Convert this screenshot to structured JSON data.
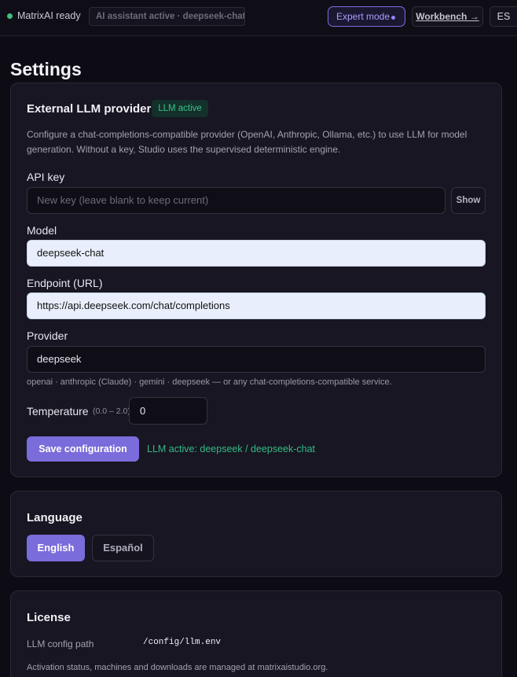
{
  "topbar": {
    "status_text": "MatrixAI ready",
    "status_color": "#3fbf7f",
    "assistant_text": "AI assistant active · deepseek-chat",
    "expert_mode_label": "Expert mode",
    "workbench_label": "Workbench →",
    "language_toggle": "ES"
  },
  "page": {
    "title": "Settings"
  },
  "llm_card": {
    "title": "External LLM provider",
    "badge": "LLM active",
    "description": "Configure a chat-completions-compatible provider (OpenAI, Anthropic, Ollama, etc.) to use LLM for model generation. Without a key, Studio uses the supervised deterministic engine.",
    "api_key": {
      "label": "API key",
      "placeholder": "New key (leave blank to keep current)",
      "show_label": "Show"
    },
    "model": {
      "label": "Model",
      "value": "deepseek-chat"
    },
    "endpoint": {
      "label": "Endpoint (URL)",
      "value": "https://api.deepseek.com/chat/completions"
    },
    "provider": {
      "label": "Provider",
      "value": "deepseek",
      "hint": "openai · anthropic (Claude) · gemini · deepseek — or any chat-completions-compatible service."
    },
    "temperature": {
      "label": "Temperature",
      "range": "(0.0 – 2.0)",
      "value": "0"
    },
    "save_label": "Save configuration",
    "save_status": "LLM active: deepseek / deepseek-chat"
  },
  "language_card": {
    "title": "Language",
    "options": [
      "English",
      "Español"
    ],
    "selected": "English"
  },
  "license_card": {
    "title": "License",
    "config_path_label": "LLM config path",
    "config_path_value": "/config/llm.env",
    "note": "Activation status, machines and downloads are managed at matrixaistudio.org."
  },
  "colors": {
    "accent": "#7a6cdb",
    "success": "#36b984",
    "background": "#0d0c15",
    "card": "#171622"
  }
}
